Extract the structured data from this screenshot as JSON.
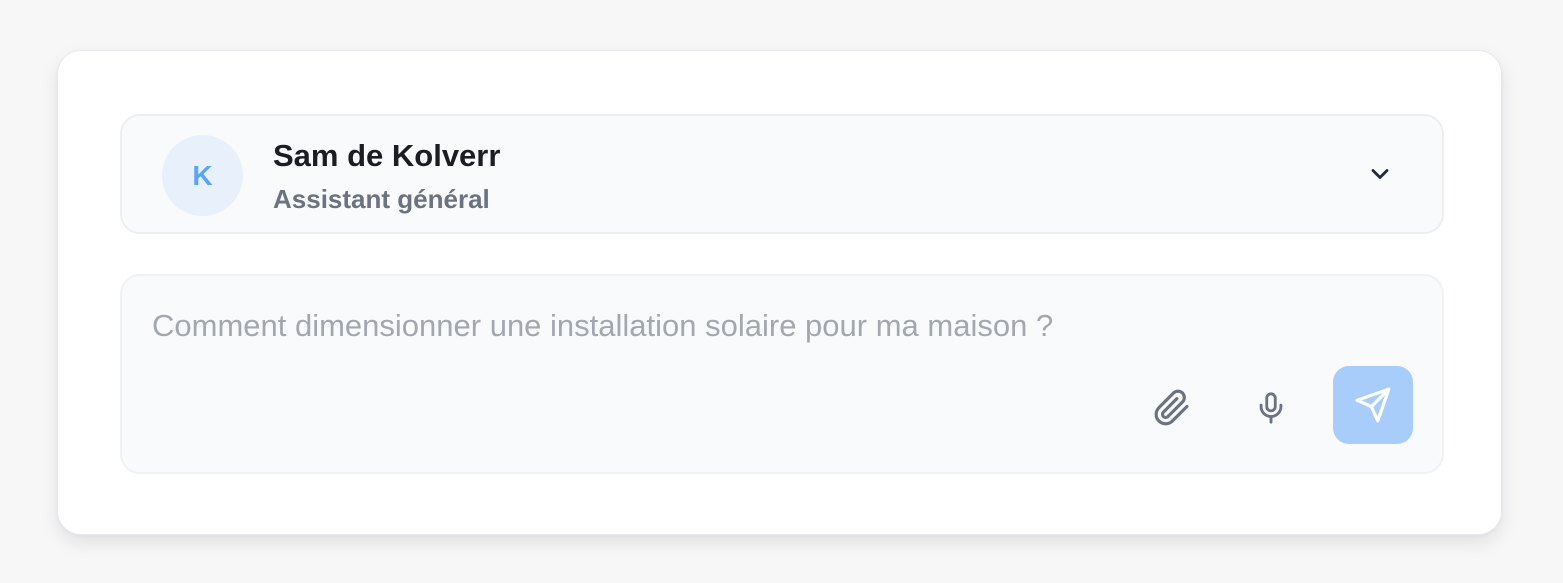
{
  "assistant": {
    "avatar_initial": "K",
    "name": "Sam de Kolverr",
    "role": "Assistant général"
  },
  "composer": {
    "placeholder": "Comment dimensionner une installation solaire pour ma maison ?"
  },
  "icons": {
    "dropdown": "chevron-down-icon",
    "attach": "paperclip-icon",
    "voice": "microphone-icon",
    "send": "send-icon"
  },
  "colors": {
    "avatar_background": "#e8f0fb",
    "avatar_text": "#5aa6f6",
    "send_button": "#a9cdfb"
  }
}
